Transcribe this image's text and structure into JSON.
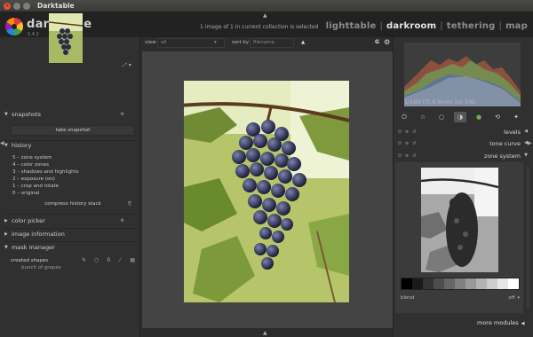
{
  "window": {
    "title": "Darktable"
  },
  "header": {
    "app_name": "darktable",
    "version": "1.4.2",
    "selection_info": "1 image of 1 in current collection is selected",
    "views": [
      "lighttable",
      "darkroom",
      "tethering",
      "map"
    ],
    "active_view": "darkroom"
  },
  "toolbar": {
    "view_label": "view",
    "view_value": "all",
    "sort_label": "sort by",
    "sort_value": "filename",
    "sort_dir_icon": "triangle-up",
    "g_label": "G",
    "gear_icon": "gear-icon"
  },
  "left_panel": {
    "snapshots": {
      "title": "snapshots",
      "button": "take snapshot"
    },
    "history": {
      "title": "history",
      "items": [
        "5 – zone system",
        "4 – color zones",
        "3 – shadows and highlights",
        "2 – exposure  (on)",
        "1 – crop and rotate",
        "0 – original"
      ],
      "compress_button": "compress history stack"
    },
    "color_picker": {
      "title": "color picker"
    },
    "image_information": {
      "title": "image information"
    },
    "mask_manager": {
      "title": "mask manager",
      "created_shapes_label": "created shapes",
      "shapes": [
        "bunch of grapes"
      ]
    }
  },
  "right_panel": {
    "histogram_info": "1/160 f/5.6 6mm iso 100",
    "modules": [
      {
        "name": "levels"
      },
      {
        "name": "tone curve"
      },
      {
        "name": "zone system"
      }
    ],
    "blend": {
      "label": "blend",
      "value": "off"
    },
    "more_modules": "more modules"
  },
  "colors": {
    "accent_bg": "#2c2c2c",
    "panel_bg": "#303030",
    "center_bg": "#444444"
  }
}
